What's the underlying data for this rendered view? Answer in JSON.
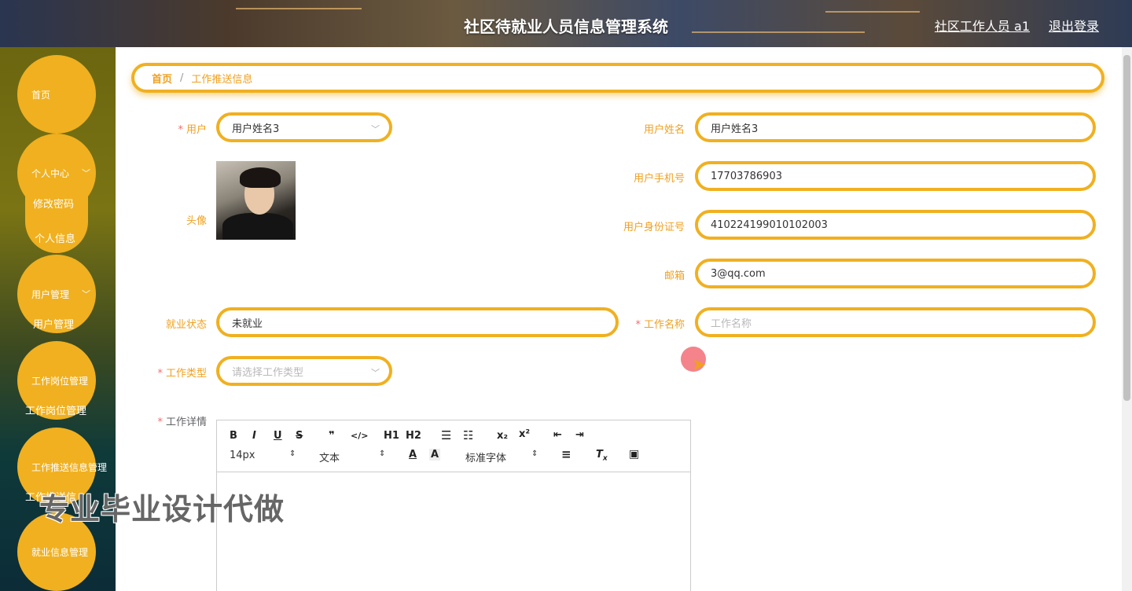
{
  "header": {
    "title": "社区待就业人员信息管理系统",
    "user": "社区工作人员 a1",
    "logout": "退出登录"
  },
  "sidebar": {
    "home": "首页",
    "personal_center": "个人中心",
    "change_password": "修改密码",
    "personal_info": "个人信息",
    "user_mgmt": "用户管理",
    "user_mgmt_sub": "用户管理",
    "job_post_mgmt": "工作岗位管理",
    "job_post_mgmt_sub": "工作岗位管理",
    "job_push_mgmt": "工作推送信息管理",
    "job_push_mgmt_sub": "工作推送信",
    "employment_mgmt": "就业信息管理"
  },
  "breadcrumb": {
    "home": "首页",
    "separator": "/",
    "current": "工作推送信息"
  },
  "form": {
    "user_label": "用户",
    "user_value": "用户姓名3",
    "avatar_label": "头像",
    "username_label": "用户姓名",
    "username_value": "用户姓名3",
    "phone_label": "用户手机号",
    "phone_value": "17703786903",
    "idcard_label": "用户身份证号",
    "idcard_value": "410224199010102003",
    "email_label": "邮箱",
    "email_value": "3@qq.com",
    "status_label": "就业状态",
    "status_value": "未就业",
    "jobname_label": "工作名称",
    "jobname_placeholder": "工作名称",
    "jobtype_label": "工作类型",
    "jobtype_placeholder": "请选择工作类型",
    "jobdetail_label": "工作详情",
    "required_mark": "*"
  },
  "editor": {
    "bold": "B",
    "italic": "I",
    "underline": "U",
    "strike": "S",
    "quote": "❞",
    "code": "</>",
    "h1": "H1",
    "h2": "H2",
    "sub": "x₂",
    "sup": "x²",
    "font_size": "14px",
    "text_style": "文本",
    "font_family": "标准字体"
  },
  "watermark": "专业毕业设计代做"
}
